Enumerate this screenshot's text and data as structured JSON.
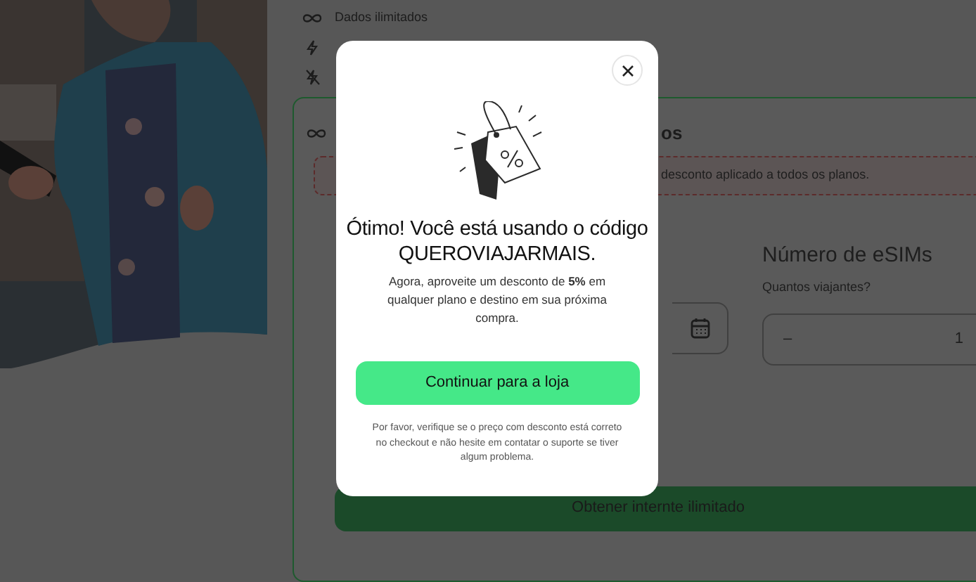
{
  "features": [
    {
      "kind": "unlimited",
      "label": "Dados ilimitados"
    },
    {
      "kind": "bolt"
    },
    {
      "kind": "bolt-off"
    }
  ],
  "plan_card": {
    "title_visible": "os",
    "notice": "desconto aplicado a todos os planos.",
    "esims": {
      "heading": "Número de eSIMs",
      "question": "Quantos viajantes?",
      "decrement": "–",
      "value": "1"
    },
    "cta": "Obtener internte ilimitado"
  },
  "modal": {
    "heading": "Ótimo! Você está usando o código QUEROVIAJARMAIS.",
    "body": "Agora, aproveite um desconto de **5%** em qualquer plano e destino em sua próxima compra.",
    "button": "Continuar para a loja",
    "footnote": "Por favor, verifique se o preço com desconto está correto no checkout e não hesite em contatar o suporte se tiver algum problema."
  }
}
